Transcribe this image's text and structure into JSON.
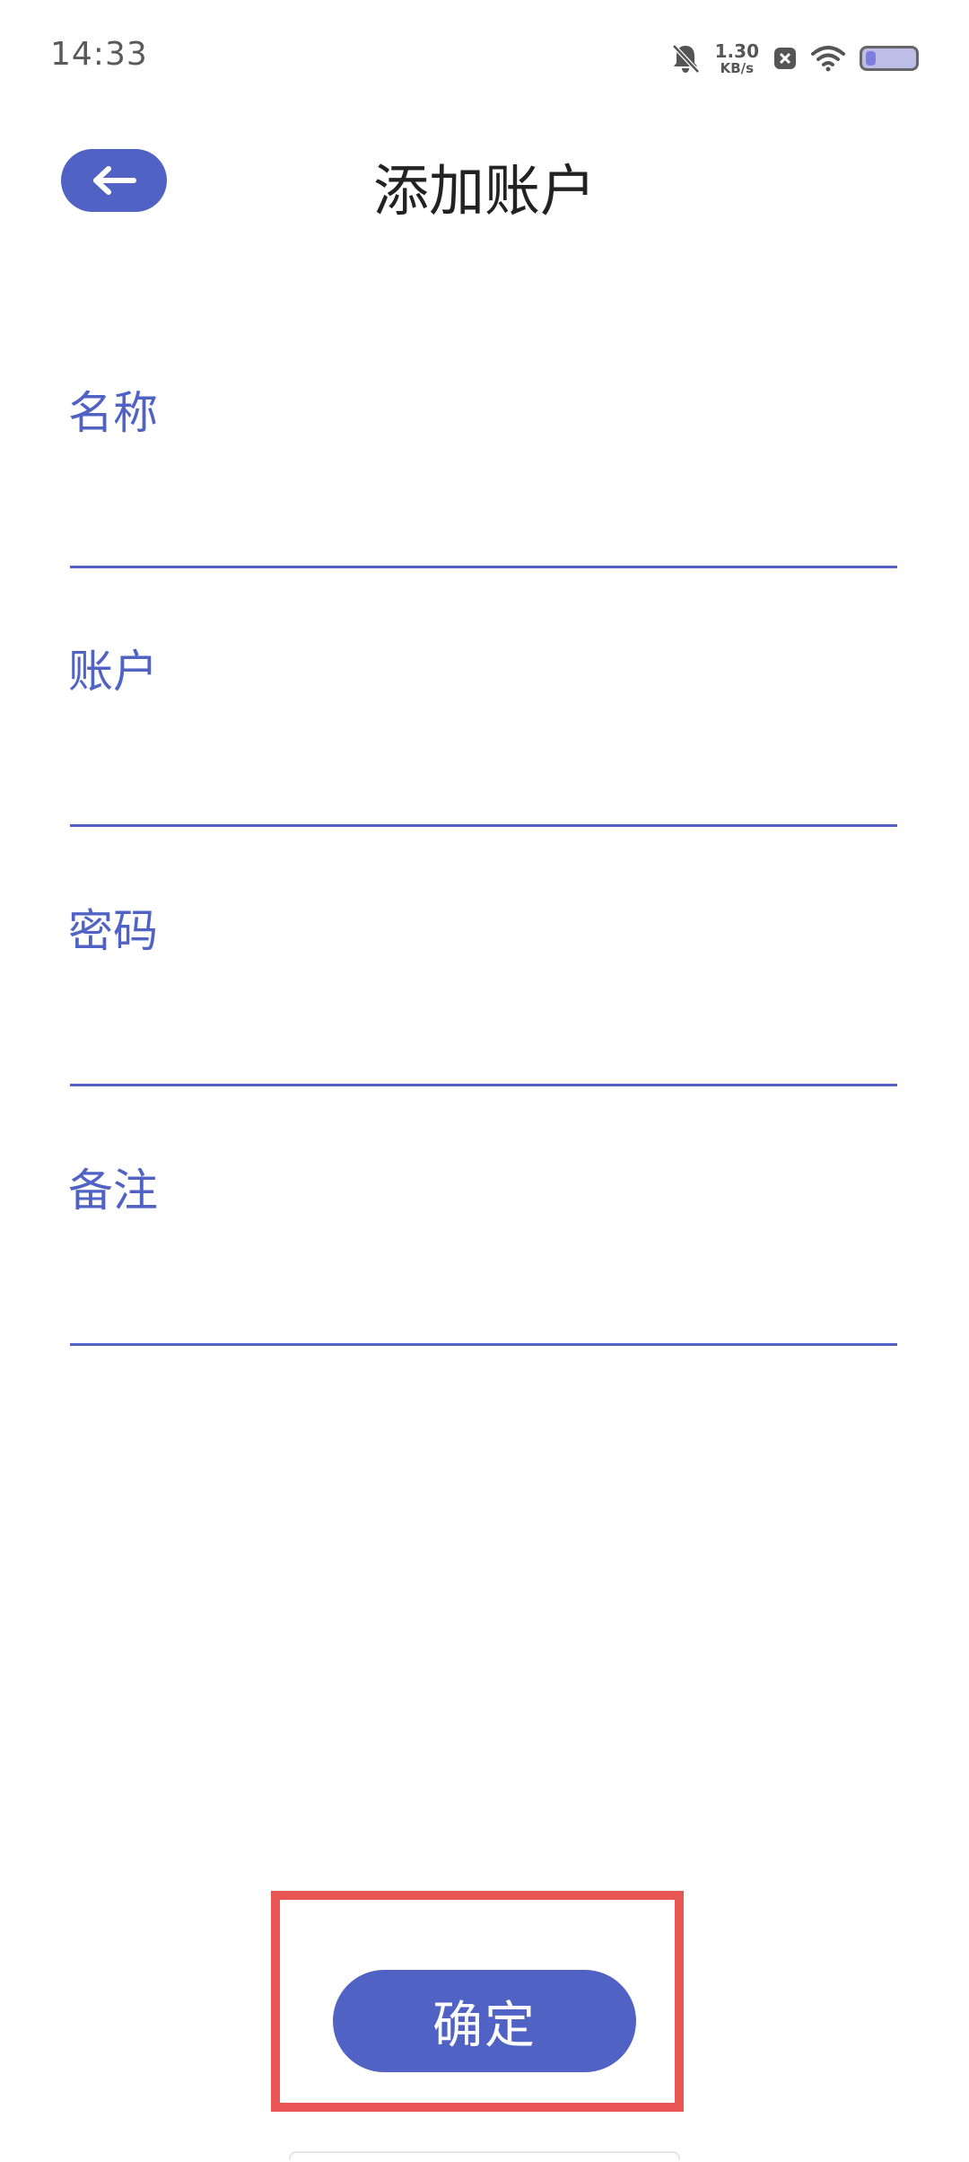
{
  "status_bar": {
    "time": "14:33",
    "net_speed_value": "1.30",
    "net_speed_unit": "KB/s",
    "battery_level": 0.2,
    "icons": [
      "bell-muted-icon",
      "net-speed",
      "close-box-icon",
      "wifi-icon",
      "battery-icon"
    ]
  },
  "header": {
    "title": "添加账户",
    "back_icon": "arrow-left-icon"
  },
  "form": {
    "fields": [
      {
        "label": "名称",
        "value": "",
        "placeholder": ""
      },
      {
        "label": "账户",
        "value": "",
        "placeholder": ""
      },
      {
        "label": "密码",
        "value": "",
        "placeholder": ""
      },
      {
        "label": "备注",
        "value": "",
        "placeholder": ""
      }
    ]
  },
  "actions": {
    "confirm_label": "确定"
  },
  "colors": {
    "accent": "#5063c4",
    "highlight": "#e85555",
    "title": "#222222",
    "status": "#5a5a5a"
  }
}
